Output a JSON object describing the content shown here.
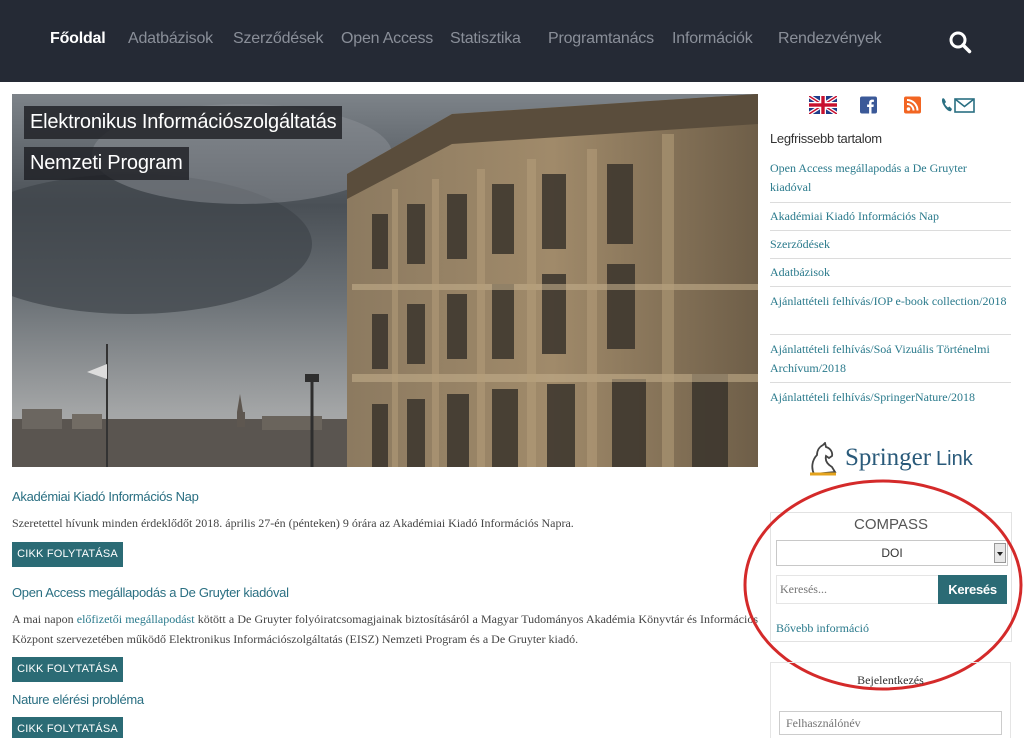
{
  "nav": {
    "items": [
      {
        "label": "Főoldal",
        "active": true
      },
      {
        "label": "Adatbázisok"
      },
      {
        "label": "Szerződések"
      },
      {
        "label": "Open Access"
      },
      {
        "label": "Statisztika"
      },
      {
        "label": "Programtanács"
      },
      {
        "label": "Információk"
      },
      {
        "label": "Rendezvények"
      }
    ],
    "search_icon": "search-icon"
  },
  "hero": {
    "title_line1": "Elektronikus Információszolgáltatás",
    "title_line2": "Nemzeti Program"
  },
  "articles": [
    {
      "title": "Akadémiai Kiadó Információs Nap",
      "text": "Szeretettel hívunk minden érdeklődőt 2018. április 27-én (pénteken) 9 órára az Akadémiai Kiadó Információs Napra.",
      "button": "CIKK FOLYTATÁSA"
    },
    {
      "title": "Open Access megállapodás a De Gruyter kiadóval",
      "text_before": "A mai napon ",
      "text_link": "előfizetői megállapodást",
      "text_after": " kötött a De Gruyter folyóiratcsomagjainak biztosításáról a Magyar Tudományos Akadémia Könyvtár és Információs Központ szervezetében működő Elektronikus Információszolgáltatás (EISZ) Nemzeti Program és a De Gruyter kiadó.",
      "button": "CIKK FOLYTATÁSA"
    },
    {
      "title": "Nature elérési probléma",
      "button": "CIKK FOLYTATÁSA"
    }
  ],
  "sidebar": {
    "social_icons": [
      "uk-flag-icon",
      "facebook-icon",
      "rss-icon",
      "contact-icon"
    ],
    "latest_heading": "Legfrissebb tartalom",
    "latest": [
      "Open Access megállapodás a De Gruyter kiadóval",
      "Akadémiai Kiadó Információs Nap",
      "Szerződések",
      "Adatbázisok",
      "Ajánlattételi felhívás/IOP e-book collection/2018",
      "Ajánlattételi felhívás/Soá Vizuális Történelmi Archívum/2018",
      "Ajánlattételi felhívás/SpringerNature/2018"
    ],
    "springer": {
      "word1": "Springer",
      "word2": "Link"
    },
    "compass": {
      "title": "COMPASS",
      "select_value": "DOI",
      "search_placeholder": "Keresés...",
      "search_button": "Keresés",
      "more_info": "Bővebb információ"
    },
    "login": {
      "title": "Bejelentkezés",
      "username_placeholder": "Felhasználónév"
    }
  },
  "colors": {
    "nav_bg": "#252a35",
    "accent": "#2b6b75",
    "link": "#2a7a8c",
    "annotation_red": "#d42a2a"
  }
}
